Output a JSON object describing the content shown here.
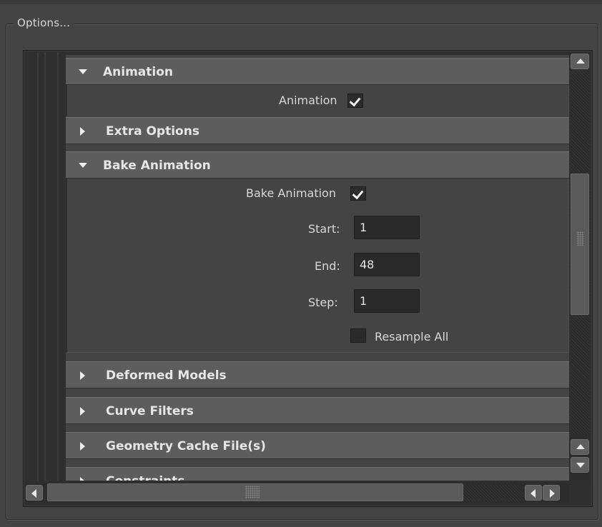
{
  "group": {
    "title": "Options..."
  },
  "sections": {
    "animation": {
      "title": "Animation",
      "checkbox_label": "Animation",
      "checked": true
    },
    "extra_options": {
      "title": "Extra Options"
    },
    "bake_animation": {
      "title": "Bake Animation",
      "checkbox_label": "Bake Animation",
      "checked": true,
      "start_label": "Start:",
      "start_value": "1",
      "end_label": "End:",
      "end_value": "48",
      "step_label": "Step:",
      "step_value": "1",
      "resample_label": "Resample All",
      "resample_checked": false
    },
    "deformed_models": {
      "title": "Deformed Models"
    },
    "curve_filters": {
      "title": "Curve Filters"
    },
    "geometry_cache": {
      "title": "Geometry Cache File(s)"
    },
    "constraints": {
      "title": "Constraints"
    }
  },
  "icons": {
    "expanded": "triangle-down-icon",
    "collapsed": "triangle-right-icon",
    "checked": "checkmark-icon"
  },
  "colors": {
    "background": "#444444",
    "header": "#5d5d5d",
    "field": "#2a2a2a",
    "text": "#d8d8d8"
  }
}
